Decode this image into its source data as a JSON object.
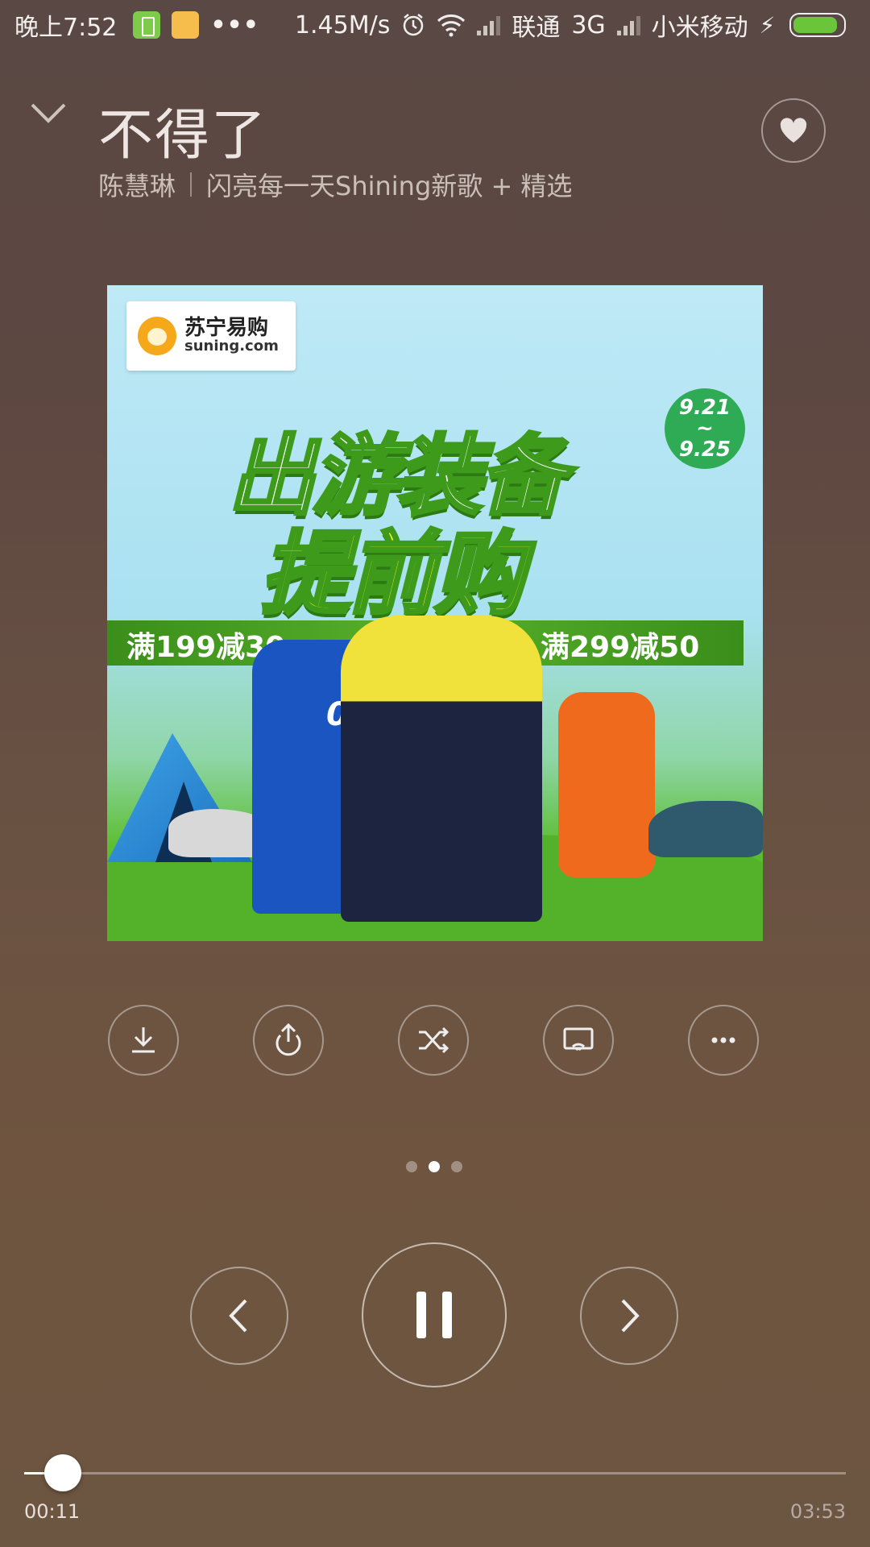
{
  "status_bar": {
    "time": "晚上7:52",
    "more": "•••",
    "speed": "1.45M/s",
    "carrier1": "联通",
    "network": "3G",
    "carrier2": "小米移动",
    "battery_level": 0.9,
    "icons": [
      "battery-app-icon",
      "notes-app-icon",
      "alarm-icon",
      "wifi-icon",
      "signal-icon",
      "charging-icon",
      "battery-icon"
    ]
  },
  "song": {
    "title": "不得了",
    "artist": "陈慧琳",
    "album": "闪亮每一天Shining新歌 + 精选"
  },
  "ad": {
    "brand_cn": "苏宁易购",
    "brand_en": "suning.com",
    "headline_1": "出游装备",
    "headline_2": "提前购",
    "date_start": "9.21",
    "date_sep": "~",
    "date_end": "9.25",
    "promo_left": "满199减30",
    "promo_right": "满299减50",
    "jacket_number": "03"
  },
  "actions": [
    "download-icon",
    "share-icon",
    "shuffle-icon",
    "cast-icon",
    "more-icon"
  ],
  "pager": {
    "count": 3,
    "active": 1
  },
  "playback": {
    "state": "playing",
    "current_time": "00:11",
    "total_time": "03:53",
    "progress": 0.047
  },
  "colors": {
    "progress_fill": "#ffffff",
    "battery": "#6ac53b"
  }
}
